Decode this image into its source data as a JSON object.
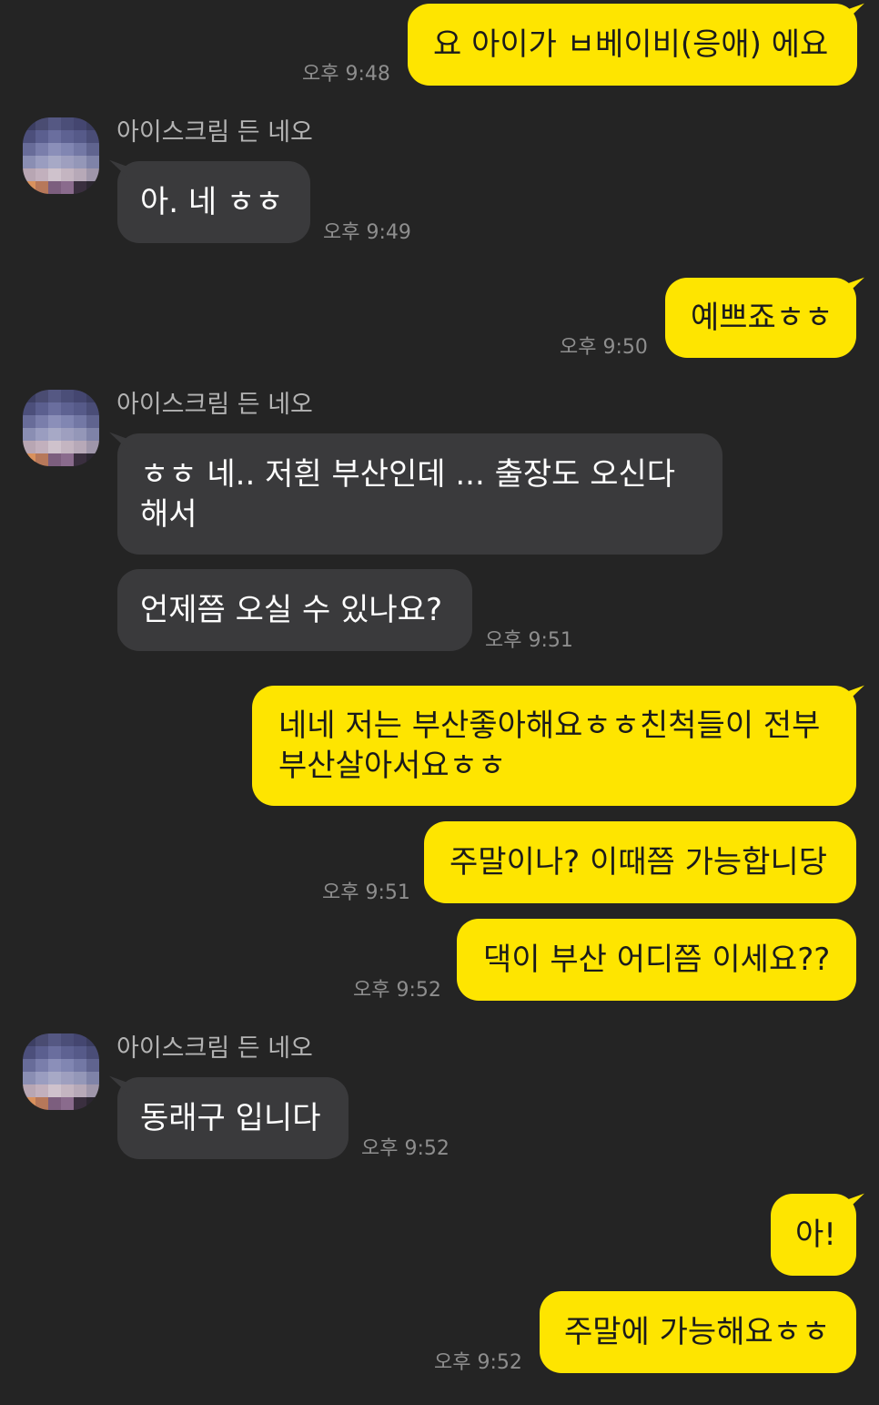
{
  "chat": {
    "partner_name": "아이스크림 든 네오",
    "messages": [
      {
        "from": "me",
        "text": "요 아이가 ㅂ베이비(응애) 에요",
        "time": "오후 9:48"
      },
      {
        "from": "them",
        "text": "아. 네 ㅎㅎ",
        "time": "오후 9:49"
      },
      {
        "from": "me",
        "text": "예쁘죠ㅎㅎ",
        "time": "오후 9:50"
      },
      {
        "from": "them",
        "text_line1": "ㅎㅎ 네..  저흰 부산인데 ... 출장도 오신다",
        "text_line2": "해서"
      },
      {
        "from": "them",
        "text": "언제쯤 오실 수 있나요?",
        "time": "오후 9:51"
      },
      {
        "from": "me",
        "text_line1": "네네 저는 부산좋아해요ㅎㅎ친척들이 전부",
        "text_line2": "부산살아서요ㅎㅎ"
      },
      {
        "from": "me",
        "text": "주말이나? 이때쯤 가능합니당",
        "time": "오후 9:51"
      },
      {
        "from": "me",
        "text": "댁이 부산 어디쯤 이세요??",
        "time": "오후 9:52"
      },
      {
        "from": "them",
        "text": "동래구 입니다",
        "time": "오후 9:52"
      },
      {
        "from": "me",
        "text": "아!"
      },
      {
        "from": "me",
        "text": "주말에 가능해요ㅎㅎ",
        "time": "오후 9:52"
      }
    ]
  },
  "colors": {
    "background": "#242424",
    "my_bubble": "#FEE500",
    "their_bubble": "#3a3a3c",
    "timestamp": "#8e8e8e",
    "name": "#b3b3b3"
  },
  "avatar_pixels": [
    "#3d3f63",
    "#4a4c72",
    "#555883",
    "#4b4e78",
    "#444670",
    "#3b3d60",
    "#4c4f7b",
    "#5b5f8f",
    "#6a6e9e",
    "#5e6292",
    "#565a89",
    "#4a4d77",
    "#686c99",
    "#7a7eab",
    "#8b8fb9",
    "#8186b2",
    "#7378a5",
    "#60648f",
    "#8a8eb3",
    "#9a9dc0",
    "#a7a9c6",
    "#9e9fbf",
    "#9497b8",
    "#7f83a8",
    "#b8a6b3",
    "#c2b0bd",
    "#cfc2cc",
    "#c4b5c1",
    "#b7a9b8",
    "#9f96aa",
    "#d9915d",
    "#b7785a",
    "#7c5e7e",
    "#8a6b8d",
    "#3a2f3f",
    "#2b2630"
  ]
}
